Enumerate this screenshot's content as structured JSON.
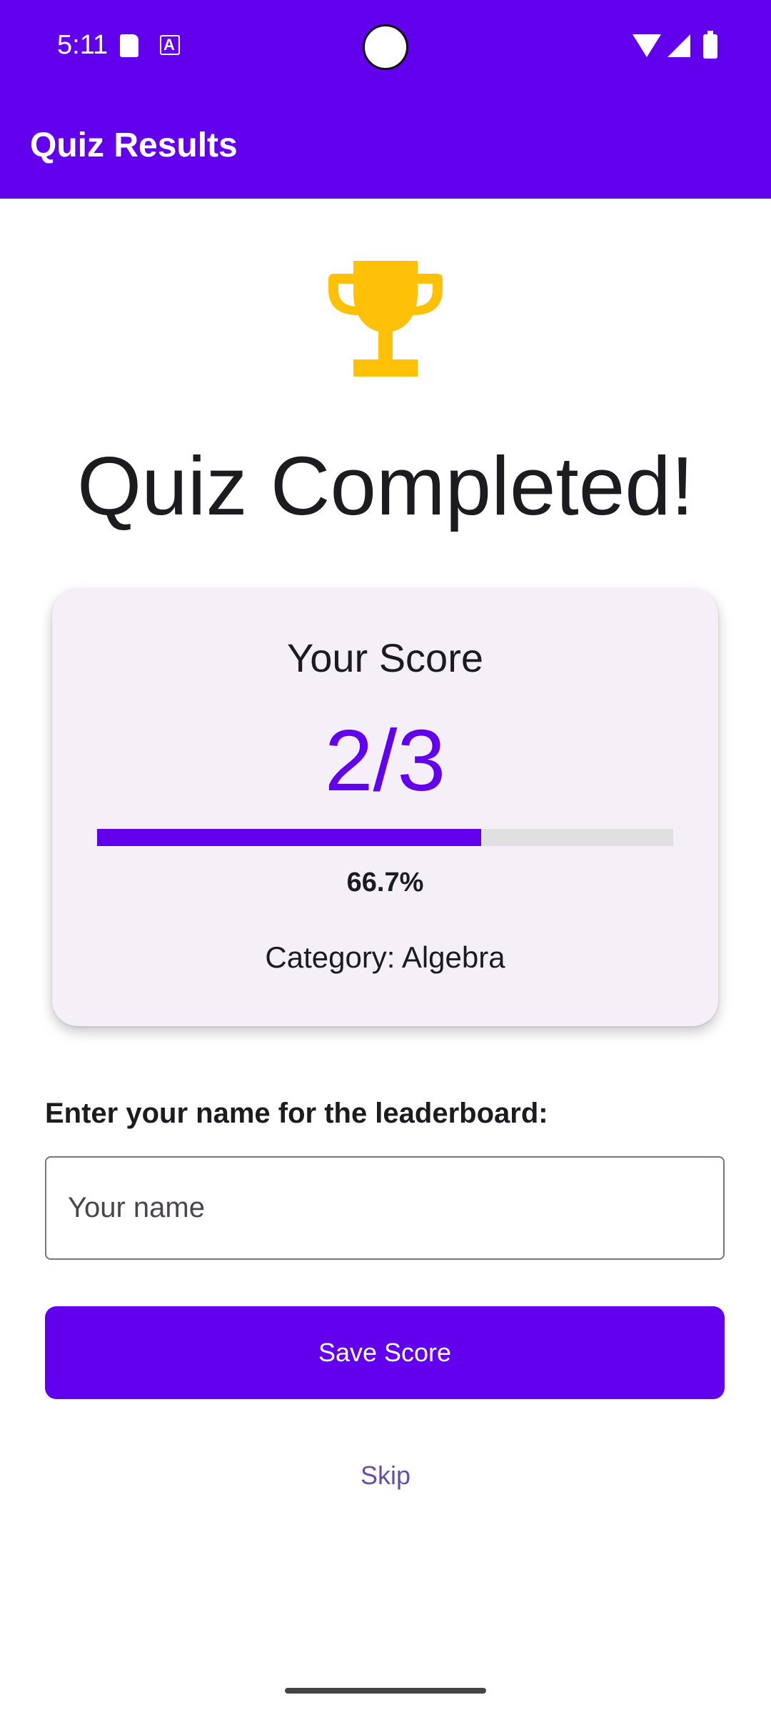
{
  "status_bar": {
    "time": "5:11"
  },
  "app_bar": {
    "title": "Quiz Results"
  },
  "main": {
    "headline": "Quiz Completed!"
  },
  "score_card": {
    "label": "Your Score",
    "score": "2/3",
    "progress_fraction": 0.667,
    "percent_text": "66.7%",
    "category": "Category: Algebra"
  },
  "leaderboard": {
    "prompt": "Enter your name for the leaderboard:",
    "name_placeholder": "Your name",
    "name_value": ""
  },
  "actions": {
    "save_label": "Save Score",
    "skip_label": "Skip"
  },
  "colors": {
    "primary": "#6200ee",
    "trophy": "#ffc107",
    "skip_text": "#6750a4"
  }
}
